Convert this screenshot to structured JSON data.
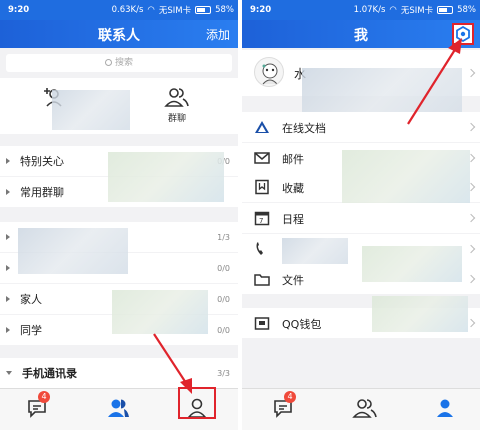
{
  "left_screen": {
    "status": {
      "time": "9:20",
      "speed": "0.63K/s",
      "sim": "无SIM卡",
      "battery": "58%"
    },
    "nav": {
      "title": "联系人",
      "add_label": "添加"
    },
    "search_placeholder": "搜索",
    "quick_actions": [
      {
        "label": "群聊"
      }
    ],
    "groups": [
      {
        "label": "特别关心",
        "count": "0/0"
      },
      {
        "label": "常用群聊",
        "count": ""
      },
      {
        "label": "",
        "count": "1/3"
      },
      {
        "label": "",
        "count": "0/0"
      },
      {
        "label": "家人",
        "count": "0/0"
      },
      {
        "label": "同学",
        "count": "0/0"
      },
      {
        "label": "手机通讯录",
        "count": "3/3"
      }
    ],
    "tabs": {
      "messages_badge": "4"
    }
  },
  "right_screen": {
    "status": {
      "time": "9:20",
      "speed": "1.07K/s",
      "sim": "无SIM卡",
      "battery": "58%"
    },
    "nav": {
      "title": "我"
    },
    "profile": {
      "name": "水"
    },
    "menu": [
      {
        "label": "在线文档",
        "icon": "cloud-doc-icon"
      },
      {
        "label": "邮件",
        "icon": "mail-icon"
      },
      {
        "label": "收藏",
        "icon": "bookmark-icon"
      },
      {
        "label": "日程",
        "icon": "calendar-icon"
      },
      {
        "label": "",
        "icon": "phone-icon"
      },
      {
        "label": "文件",
        "icon": "folder-icon"
      },
      {
        "label": "QQ钱包",
        "icon": "wallet-icon"
      }
    ],
    "tabs": {
      "messages_badge": "4"
    }
  },
  "colors": {
    "header_blue": "#1f6de0",
    "accent_blue": "#1a73e8",
    "annotation_red": "#e0242c"
  }
}
